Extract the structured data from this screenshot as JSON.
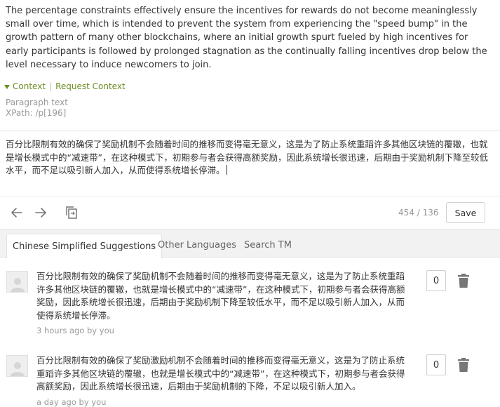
{
  "source_text": "The percentage constraints effectively ensure the incentives for rewards do not become meaninglessly small over time, which is intended to prevent the system from experiencing the \"speed bump\" in the growth pattern of many other blockchains, where an initial growth spurt fueled by high incentives for early participants is followed by prolonged stagnation as the continually falling incentives drop below the level necessary to induce newcomers to join.",
  "context": {
    "context_label": "Context",
    "request_label": "Request Context"
  },
  "meta": {
    "type": "Paragraph text",
    "xpath": "XPath: /p[196]"
  },
  "translation_text": "百分比限制有效的确保了奖励机制不会随着时间的推移而变得毫无意义，这是为了防止系统重蹈许多其他区块链的覆辙，也就是增长模式中的“减速带”，在这种模式下，初期参与者会获得高额奖励，因此系统增长很迅速，后期由于奖励机制下降至较低水平，而不足以吸引新人加入，从而使得系统增长停滞。",
  "toolbar": {
    "counter": "454 / 136",
    "save_label": "Save"
  },
  "tabs": [
    {
      "label": "Chinese Simplified Suggestions",
      "active": true
    },
    {
      "label": "Other Languages",
      "active": false
    },
    {
      "label": "Search TM",
      "active": false
    }
  ],
  "suggestions": [
    {
      "text": "百分比限制有效的确保了奖励机制不会随着时间的推移而变得毫无意义，这是为了防止系统重蹈许多其他区块链的覆辙，也就是增长模式中的“减速带”，在这种模式下，初期参与者会获得高额奖励，因此系统增长很迅速，后期由于奖励机制下降至较低水平，而不足以吸引新人加入，从而使得系统增长停滞。",
      "time": "3 hours ago by you",
      "votes": "0"
    },
    {
      "text": "百分比限制有效的确保了奖励激励机制不会随着时间的推移而变得毫无意义，这是为了防止系统重蹈许多其他区块链的覆辙，也就是增长模式中的“减速带”，在这种模式下，初期参与者会获得高额奖励，因此系统增长很迅速，后期由于奖励机制的下降，不足以吸引新人加入。",
      "time": "a day ago by you",
      "votes": "0"
    }
  ],
  "icons": {
    "back": "arrow-left-icon",
    "forward": "arrow-right-icon",
    "copy": "copy-source-icon",
    "delete": "trash-icon",
    "avatar": "user-avatar-icon"
  },
  "colors": {
    "context_green": "#6b8e23",
    "muted": "#999999",
    "icon_gray": "#777777"
  }
}
